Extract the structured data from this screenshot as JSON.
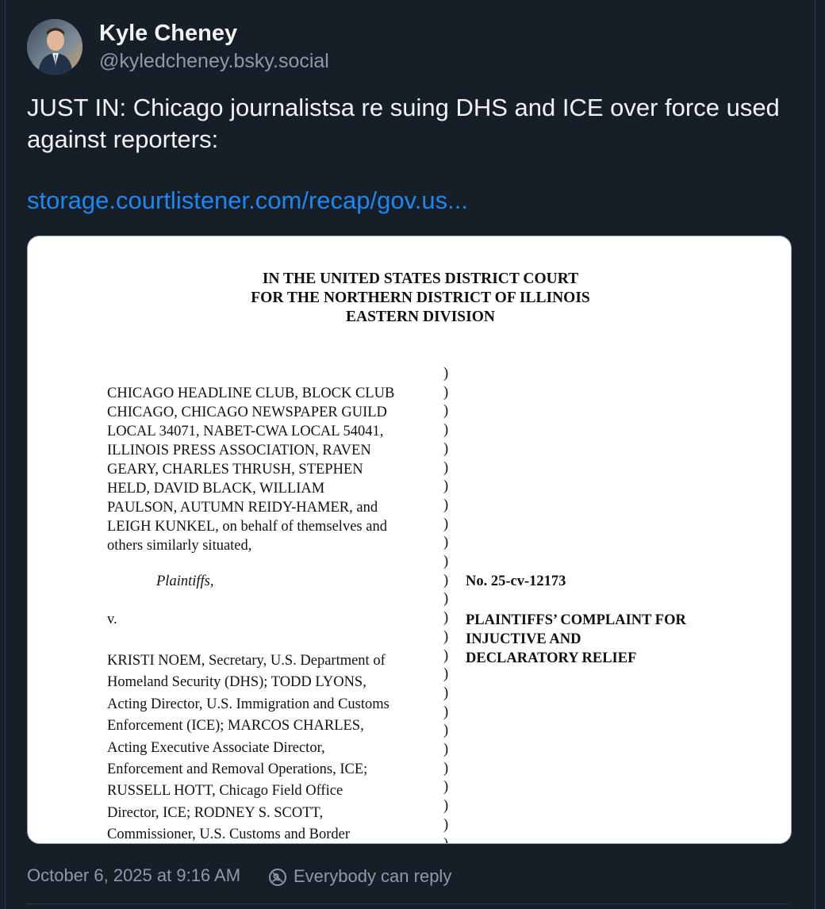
{
  "author": {
    "name": "Kyle Cheney",
    "handle": "@kyledcheney.bsky.social"
  },
  "post": {
    "text": "JUST IN: Chicago journalistsa re suing DHS and ICE over force used against reporters:",
    "link_text": "storage.courtlistener.com/recap/gov.us..."
  },
  "document": {
    "header": [
      "IN THE UNITED STATES DISTRICT COURT",
      "FOR THE NORTHERN DISTRICT OF ILLINOIS",
      "EASTERN DIVISION"
    ],
    "plaintiffs_lines": [
      "CHICAGO HEADLINE CLUB, BLOCK CLUB",
      "CHICAGO, CHICAGO NEWSPAPER GUILD",
      "LOCAL 34071, NABET-CWA LOCAL 54041,",
      "ILLINOIS PRESS ASSOCIATION, RAVEN",
      "GEARY, CHARLES THRUSH, STEPHEN",
      "HELD, DAVID BLACK, WILLIAM",
      "PAULSON, AUTUMN REIDY-HAMER, and",
      "LEIGH KUNKEL, on behalf of themselves and",
      "others similarly situated,"
    ],
    "plaintiffs_label": "Plaintiffs,",
    "versus": "v.",
    "defendants_lines": [
      "KRISTI NOEM, Secretary, U.S. Department of",
      "Homeland Security (DHS); TODD LYONS,",
      "Acting Director, U.S. Immigration and Customs",
      "Enforcement (ICE); MARCOS CHARLES,",
      "Acting Executive Associate Director,",
      "Enforcement and Removal Operations, ICE;",
      "RUSSELL HOTT, Chicago Field Office",
      "Director, ICE; RODNEY S. SCOTT,",
      "Commissioner, U.S. Customs and Border"
    ],
    "case_number": "No. 25-cv-12173",
    "complaint_title": [
      "PLAINTIFFS’ COMPLAINT FOR",
      "INJUCTIVE AND",
      "DECLARATORY RELIEF"
    ]
  },
  "footer": {
    "timestamp": "October 6, 2025 at 9:16 AM",
    "reply_setting": "Everybody can reply",
    "reply_icon": "everybody-reply-icon"
  }
}
